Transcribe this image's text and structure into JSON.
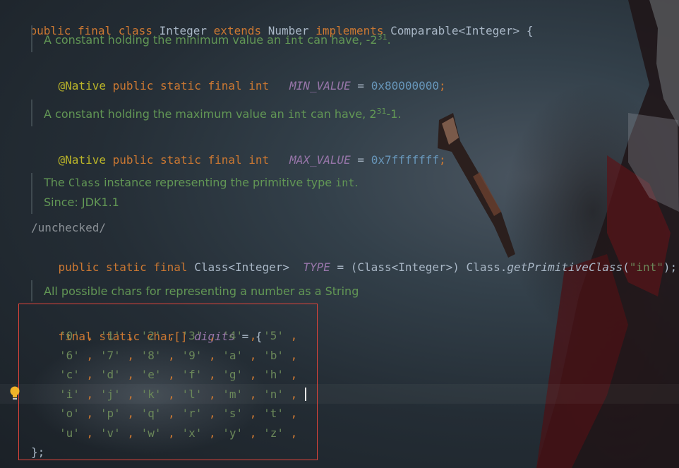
{
  "header": {
    "kw_public": "public",
    "kw_final": "final",
    "kw_class": "class",
    "class_name": "Integer",
    "kw_extends": "extends",
    "super_name": "Number",
    "kw_implements": "implements",
    "iface": "Comparable<Integer>",
    "brace": "{"
  },
  "doc1": {
    "pre": "A constant holding the minimum value an ",
    "code": "int",
    "post": " can have, -2",
    "sup": "31",
    "end": "."
  },
  "min": {
    "annotation": "@Native",
    "mods": "public static final int",
    "name": "MIN_VALUE",
    "eq": "=",
    "value": "0x80000000",
    "semi": ";"
  },
  "doc2": {
    "pre": "A constant holding the maximum value an ",
    "code": "int",
    "post": " can have, 2",
    "sup": "31",
    "end": "-1."
  },
  "max": {
    "annotation": "@Native",
    "mods": "public static final int",
    "name": "MAX_VALUE",
    "eq": "=",
    "value": "0x7fffffff",
    "semi": ";"
  },
  "doc3": {
    "pre": "The ",
    "code1": "Class",
    "mid": " instance representing the primitive type ",
    "code2": "int",
    "end": ".",
    "since": "Since: JDK1.1"
  },
  "unchecked": "/unchecked/",
  "type_decl": {
    "mods": "public static final",
    "type": "Class<Integer>",
    "name": "TYPE",
    "eq": "=",
    "cast": "(Class<Integer>)",
    "cls": "Class.",
    "method": "getPrimitiveClass",
    "open": "(",
    "arg": "\"int\"",
    "close": ");"
  },
  "doc4": "All possible chars for representing a number as a String",
  "digits_decl": {
    "mods": "final static",
    "type": "char[]",
    "name": "digits",
    "eq": "= {"
  },
  "digits_rows": [
    [
      "'0'",
      "'1'",
      "'2'",
      "'3'",
      "'4'",
      "'5'"
    ],
    [
      "'6'",
      "'7'",
      "'8'",
      "'9'",
      "'a'",
      "'b'"
    ],
    [
      "'c'",
      "'d'",
      "'e'",
      "'f'",
      "'g'",
      "'h'"
    ],
    [
      "'i'",
      "'j'",
      "'k'",
      "'l'",
      "'m'",
      "'n'"
    ],
    [
      "'o'",
      "'p'",
      "'q'",
      "'r'",
      "'s'",
      "'t'"
    ],
    [
      "'u'",
      "'v'",
      "'w'",
      "'x'",
      "'y'",
      "'z'"
    ]
  ],
  "digits_close": "};",
  "icons": {
    "gutter": "lightbulb-icon"
  },
  "colors": {
    "keyword": "#cc7832",
    "annotation": "#bbb529",
    "field": "#9876aa",
    "number": "#6897bb",
    "string": "#6a8759",
    "doc": "#629755",
    "plain": "#a9b7c6",
    "highlight_box": "#e0443a"
  }
}
